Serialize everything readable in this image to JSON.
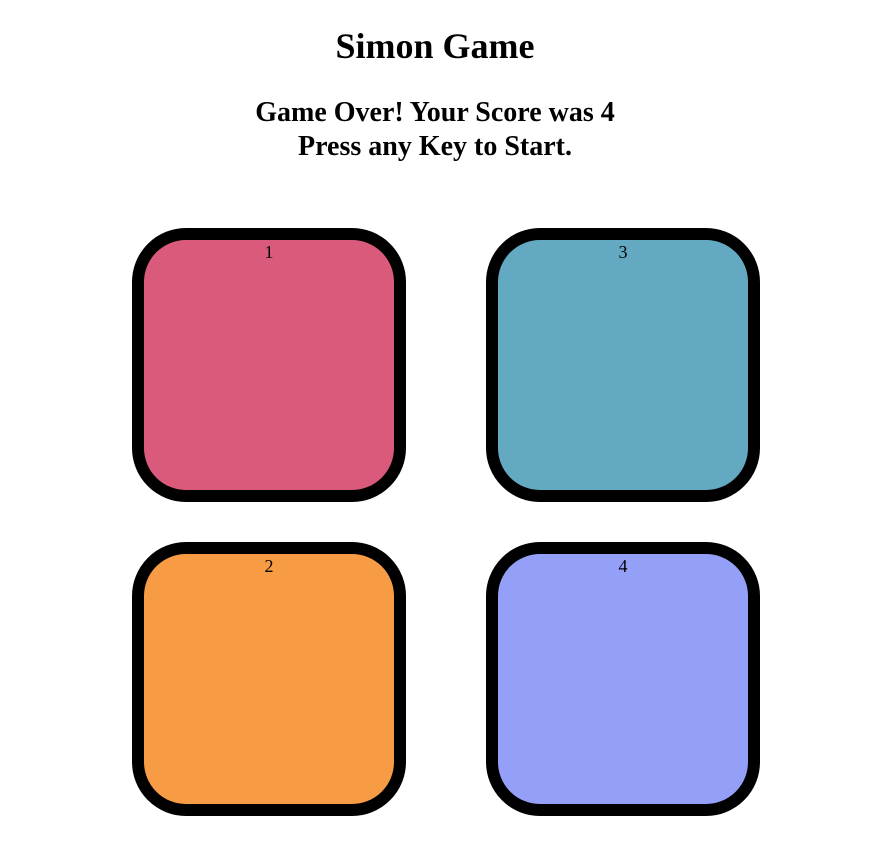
{
  "title": "Simon Game",
  "status": {
    "line1": "Game Over! Your Score was 4",
    "line2": "Press any Key to Start."
  },
  "buttons": [
    {
      "label": "1",
      "color": "#da5a7c"
    },
    {
      "label": "3",
      "color": "#63a9c1"
    },
    {
      "label": "2",
      "color": "#f89b45"
    },
    {
      "label": "4",
      "color": "#949ff7"
    }
  ]
}
